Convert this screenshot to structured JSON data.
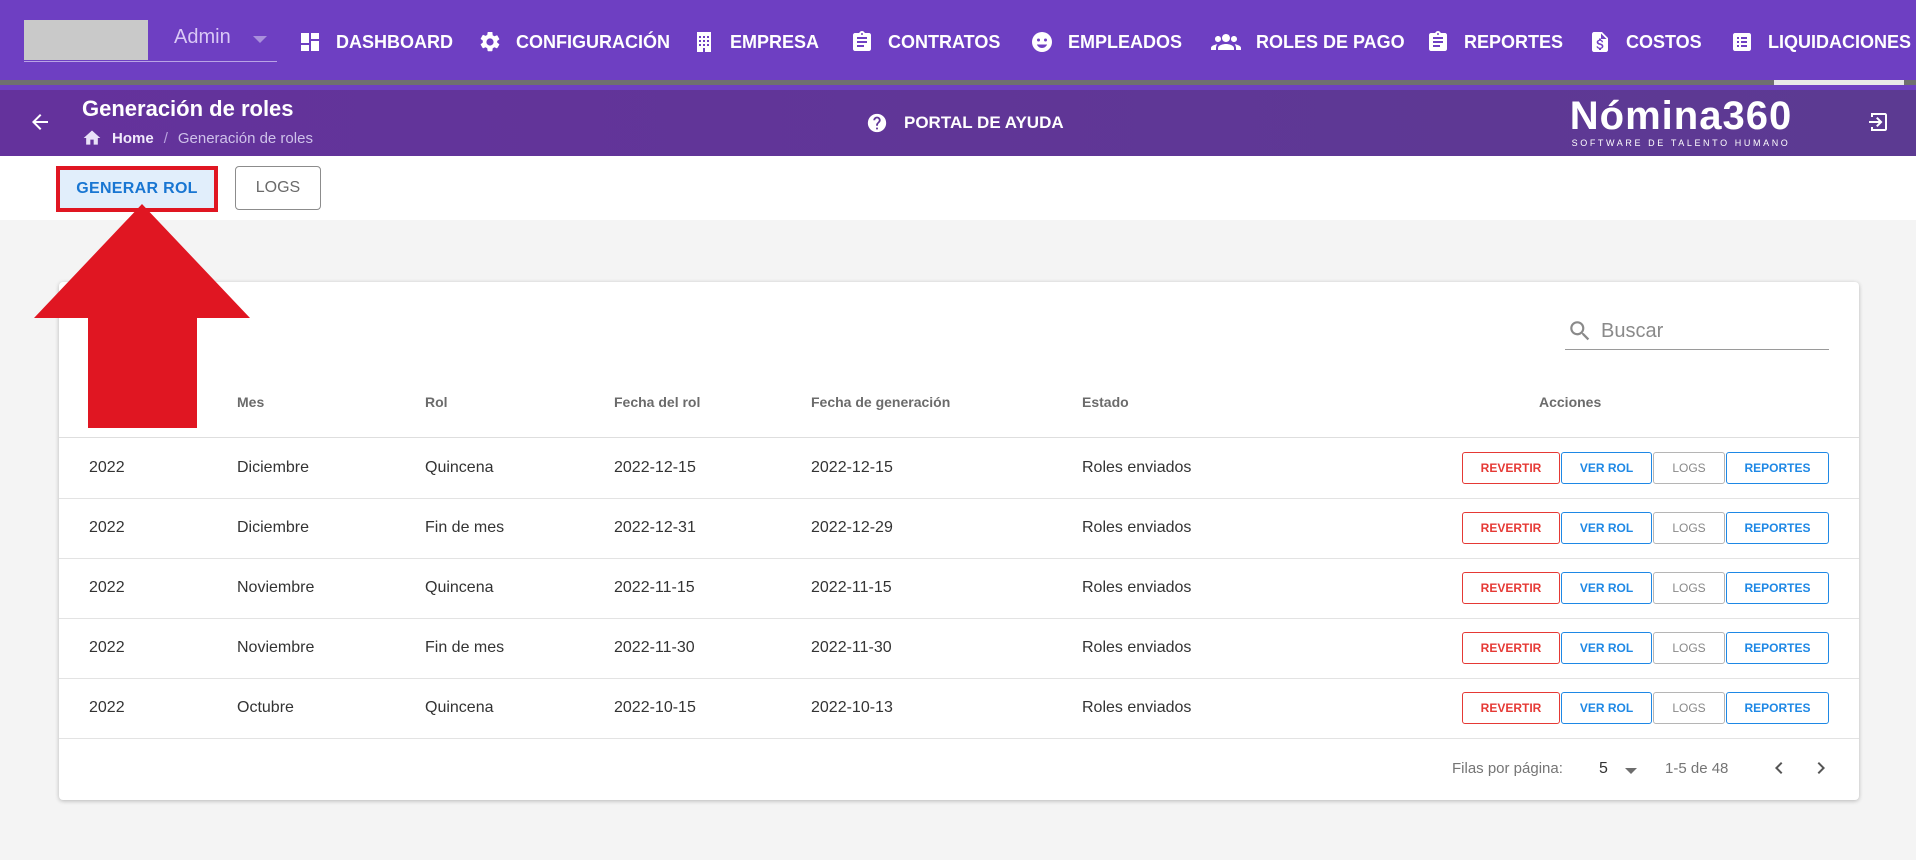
{
  "topnav": {
    "user_name": "Admin",
    "items": [
      {
        "label": "DASHBOARD",
        "icon": "dashboard-icon"
      },
      {
        "label": "CONFIGURACIÓN",
        "icon": "gear-icon"
      },
      {
        "label": "EMPRESA",
        "icon": "building-icon"
      },
      {
        "label": "CONTRATOS",
        "icon": "clipboard-icon"
      },
      {
        "label": "EMPLEADOS",
        "icon": "face-icon"
      },
      {
        "label": "ROLES DE PAGO",
        "icon": "group-icon"
      },
      {
        "label": "REPORTES",
        "icon": "clipboard-icon"
      },
      {
        "label": "COSTOS",
        "icon": "file-dollar-icon"
      },
      {
        "label": "LIQUIDACIONES",
        "icon": "list-icon"
      }
    ]
  },
  "subheader": {
    "title": "Generación de roles",
    "breadcrumb_home": "Home",
    "breadcrumb_current": "Generación de roles",
    "help_label": "PORTAL DE AYUDA",
    "brand_name": "Nómina360",
    "brand_tagline": "SOFTWARE DE TALENTO HUMANO"
  },
  "actionbar": {
    "generar_label": "GENERAR ROL",
    "logs_label": "LOGS"
  },
  "colors": {
    "nav_purple": "#6e3fc2",
    "annotation_red": "#e01622",
    "primary_blue": "#1976d2",
    "danger_red": "#e53935"
  },
  "table": {
    "search_placeholder": "Buscar",
    "headers": {
      "mes": "Mes",
      "rol": "Rol",
      "fecha_rol": "Fecha del rol",
      "fecha_generacion": "Fecha de generación",
      "estado": "Estado",
      "acciones": "Acciones"
    },
    "rows": [
      {
        "anio": "2022",
        "mes": "Diciembre",
        "rol": "Quincena",
        "fecha_rol": "2022-12-15",
        "fecha_generacion": "2022-12-15",
        "estado": "Roles enviados"
      },
      {
        "anio": "2022",
        "mes": "Diciembre",
        "rol": "Fin de mes",
        "fecha_rol": "2022-12-31",
        "fecha_generacion": "2022-12-29",
        "estado": "Roles enviados"
      },
      {
        "anio": "2022",
        "mes": "Noviembre",
        "rol": "Quincena",
        "fecha_rol": "2022-11-15",
        "fecha_generacion": "2022-11-15",
        "estado": "Roles enviados"
      },
      {
        "anio": "2022",
        "mes": "Noviembre",
        "rol": "Fin de mes",
        "fecha_rol": "2022-11-30",
        "fecha_generacion": "2022-11-30",
        "estado": "Roles enviados"
      },
      {
        "anio": "2022",
        "mes": "Octubre",
        "rol": "Quincena",
        "fecha_rol": "2022-10-15",
        "fecha_generacion": "2022-10-13",
        "estado": "Roles enviados"
      }
    ],
    "actions": {
      "revertir": "REVERTIR",
      "ver_rol": "VER ROL",
      "logs": "LOGS",
      "reportes": "REPORTES"
    },
    "pagination": {
      "rows_per_page_label": "Filas por página:",
      "rows_per_page_value": "5",
      "range_label": "1-5 de 48"
    }
  }
}
